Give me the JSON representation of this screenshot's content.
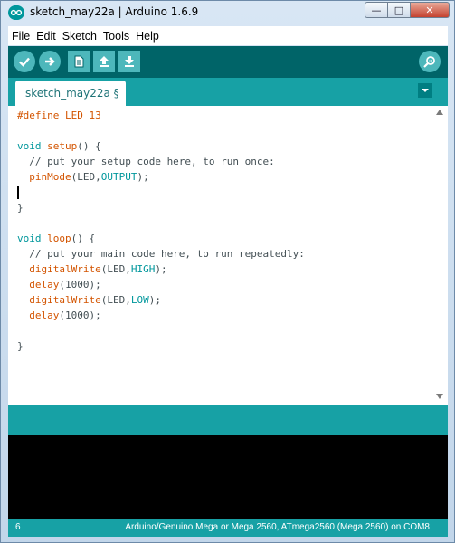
{
  "window": {
    "title": "sketch_may22a | Arduino 1.6.9",
    "min_glyph": "—",
    "max_glyph": "□",
    "close_glyph": "✕"
  },
  "menu": {
    "items": [
      "File",
      "Edit",
      "Sketch",
      "Tools",
      "Help"
    ]
  },
  "toolbar": {
    "buttons": [
      "verify-icon",
      "upload-icon",
      "new-icon",
      "open-icon",
      "save-icon"
    ],
    "serial_monitor": "serial-monitor-icon"
  },
  "tabs": {
    "active_label": "sketch_may22a §"
  },
  "editor": {
    "lines": [
      "#define LED 13",
      "",
      "void setup() {",
      "  // put your setup code here, to run once:",
      "  pinMode(LED,OUTPUT);",
      "",
      "}",
      "",
      "void loop() {",
      "  // put your main code here, to run repeatedly:",
      "  digitalWrite(LED,HIGH);",
      "  delay(1000);",
      "  digitalWrite(LED,LOW);",
      "  delay(1000);",
      "",
      "}"
    ],
    "cursor_line": 6
  },
  "status": {
    "line_number": "6",
    "board": "Arduino/Genuino Mega or Mega 2560, ATmega2560 (Mega 2560) on COM8"
  },
  "colors": {
    "teal_dark": "#006468",
    "teal": "#17a1a5",
    "orange_kw": "#d35400",
    "teal_kw": "#00979c"
  }
}
